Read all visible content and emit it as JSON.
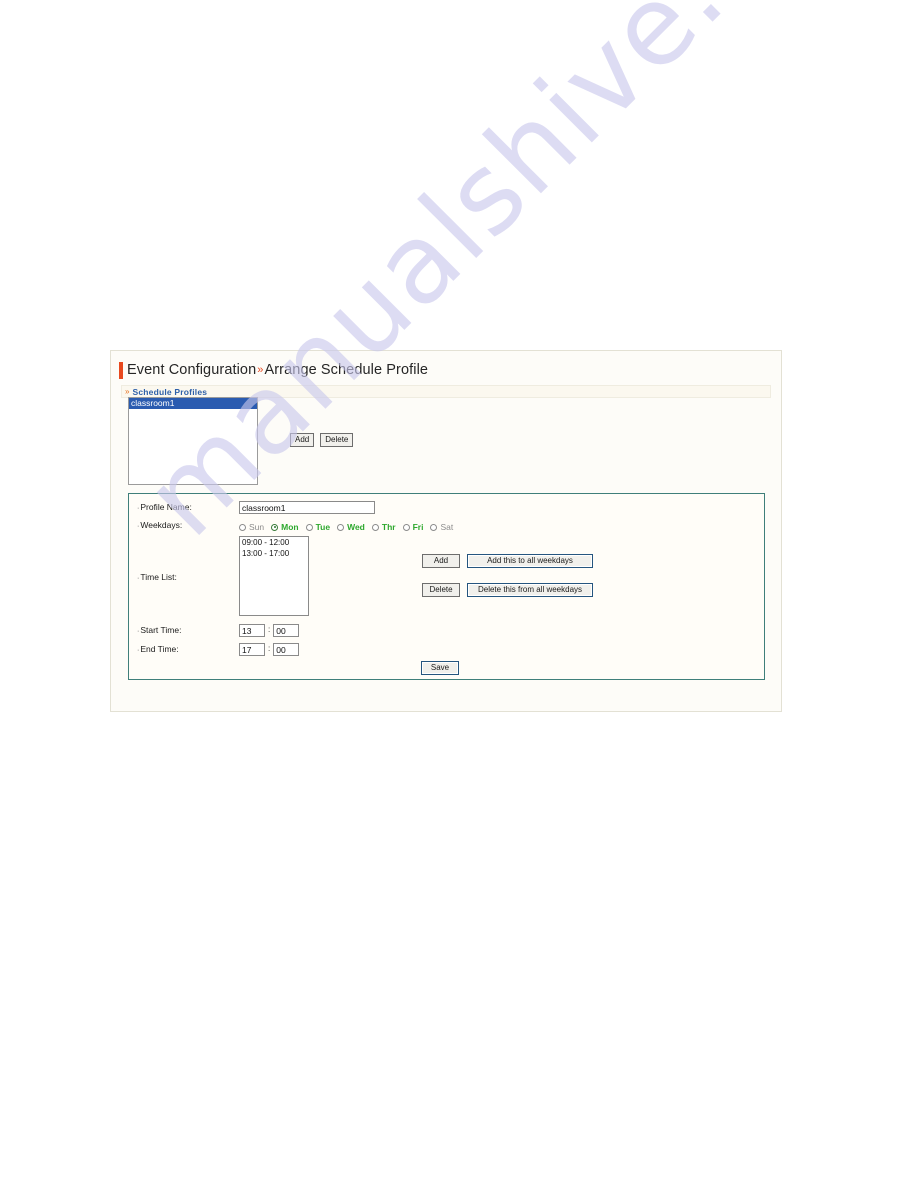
{
  "watermark": {
    "text": "manualshive.com"
  },
  "panel": {
    "title": {
      "primary": "Event Configuration",
      "separator": "»",
      "secondary": "Arrange Schedule Profile"
    },
    "section": {
      "chevron": "»",
      "label": "Schedule Profiles"
    },
    "profiles": {
      "items": [
        {
          "label": "classroom1",
          "selected": true
        }
      ],
      "buttons": {
        "add": "Add",
        "delete": "Delete"
      }
    },
    "detail": {
      "profile_name": {
        "label": "Profile Name:",
        "value": "classroom1"
      },
      "weekdays": {
        "label": "Weekdays:",
        "options": [
          {
            "label": "Sun",
            "checked": false,
            "active": false
          },
          {
            "label": "Mon",
            "checked": true,
            "active": true
          },
          {
            "label": "Tue",
            "checked": false,
            "active": true
          },
          {
            "label": "Wed",
            "checked": false,
            "active": true
          },
          {
            "label": "Thr",
            "checked": false,
            "active": true
          },
          {
            "label": "Fri",
            "checked": false,
            "active": true
          },
          {
            "label": "Sat",
            "checked": false,
            "active": false
          }
        ]
      },
      "time_list": {
        "label": "Time List:",
        "items": [
          "09:00 - 12:00",
          "13:00 - 17:00"
        ],
        "buttons": {
          "add": "Add",
          "add_all": "Add this to all weekdays",
          "delete": "Delete",
          "delete_all": "Delete this from all weekdays"
        }
      },
      "start_time": {
        "label": "Start Time:",
        "hour": "13",
        "separator": ":",
        "minute": "00"
      },
      "end_time": {
        "label": "End Time:",
        "hour": "17",
        "separator": ":",
        "minute": "00"
      },
      "save_button": "Save"
    }
  },
  "colors": {
    "accent_orange": "#e8491f",
    "section_blue": "#2d5fa8",
    "selection_blue": "#2a5bb0",
    "weekday_active_green": "#2ea82e",
    "weekday_inactive_gray": "#8c8c8c",
    "fieldset_border_teal": "#3f7f7a",
    "watermark_lavender": "#c9c8ec"
  }
}
